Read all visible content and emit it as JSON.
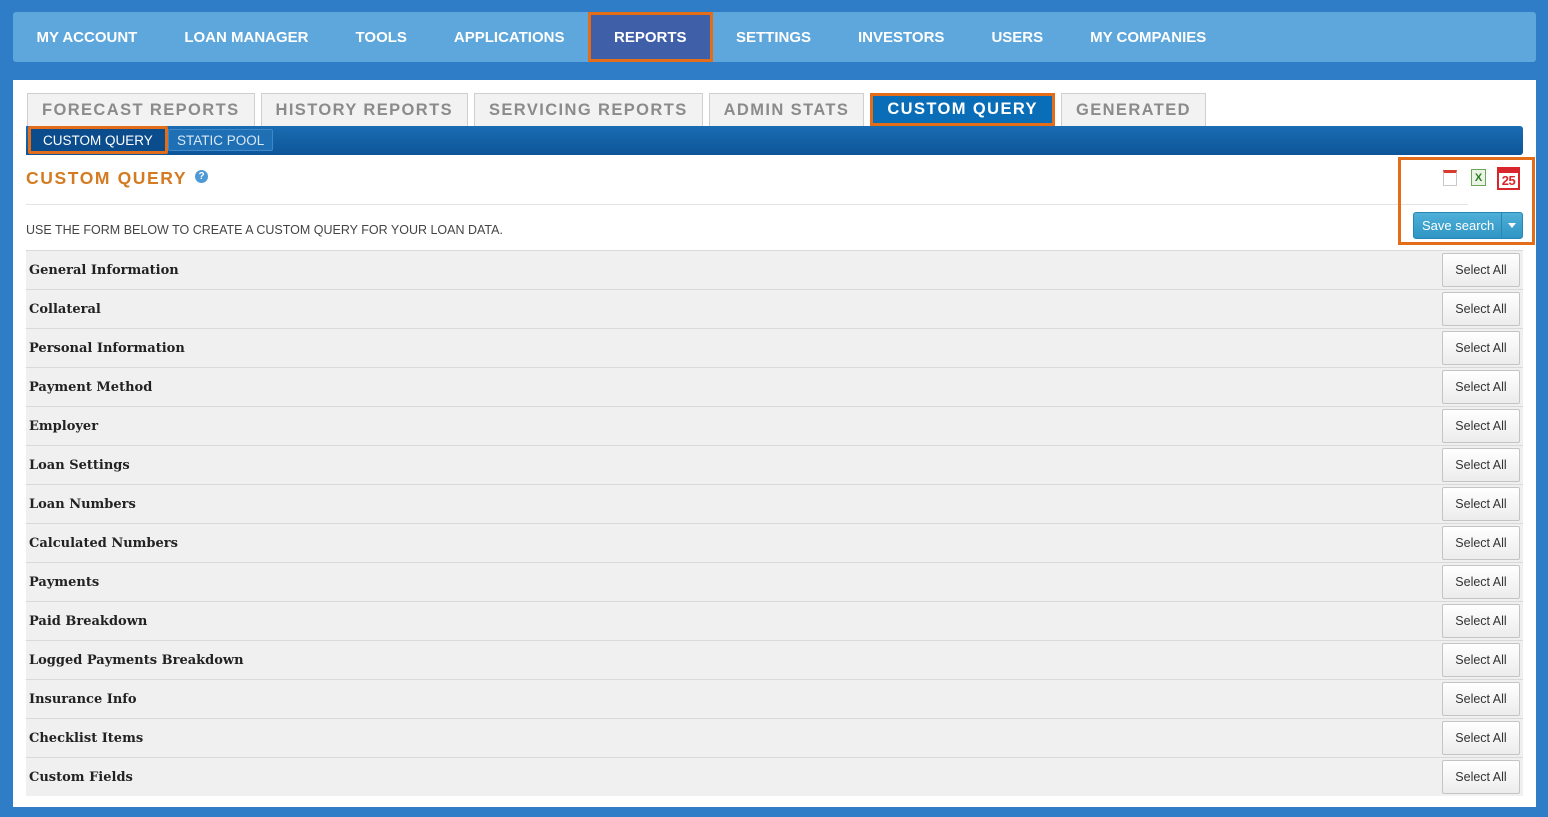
{
  "top_nav": {
    "items": [
      {
        "label": "MY ACCOUNT",
        "active": false
      },
      {
        "label": "LOAN MANAGER",
        "active": false
      },
      {
        "label": "TOOLS",
        "active": false
      },
      {
        "label": "APPLICATIONS",
        "active": false
      },
      {
        "label": "REPORTS",
        "active": true
      },
      {
        "label": "SETTINGS",
        "active": false
      },
      {
        "label": "INVESTORS",
        "active": false
      },
      {
        "label": "USERS",
        "active": false
      },
      {
        "label": "MY COMPANIES",
        "active": false
      }
    ]
  },
  "report_tabs": [
    {
      "label": "FORECAST REPORTS",
      "active": false
    },
    {
      "label": "HISTORY REPORTS",
      "active": false
    },
    {
      "label": "SERVICING REPORTS",
      "active": false
    },
    {
      "label": "ADMIN STATS",
      "active": false
    },
    {
      "label": "CUSTOM QUERY",
      "active": true
    },
    {
      "label": "GENERATED",
      "active": false
    }
  ],
  "sub_tabs": [
    {
      "label": "CUSTOM QUERY",
      "active": true
    },
    {
      "label": "STATIC POOL",
      "active": false
    }
  ],
  "page": {
    "title": "CUSTOM QUERY",
    "help_icon": "help-icon",
    "intro": "USE THE FORM BELOW TO CREATE A CUSTOM QUERY FOR YOUR LOAN DATA."
  },
  "actions": {
    "export_icons": [
      "pdf-icon",
      "excel-icon",
      "calendar-icon"
    ],
    "calendar_day": "25",
    "excel_glyph": "X",
    "save_label": "Save search"
  },
  "sections": {
    "select_all_label": "Select All",
    "items": [
      "General Information",
      "Collateral",
      "Personal Information",
      "Payment Method",
      "Employer",
      "Loan Settings",
      "Loan Numbers",
      "Calculated Numbers",
      "Payments",
      "Paid Breakdown",
      "Logged Payments Breakdown",
      "Insurance Info",
      "Checklist Items",
      "Custom Fields"
    ]
  },
  "colors": {
    "page_bg": "#2f7cc7",
    "nav_bg": "#5ea7dc",
    "nav_active": "#3f5fa8",
    "highlight": "#e46d1a",
    "title_orange": "#d47b22",
    "tab_active": "#0a6db8"
  }
}
